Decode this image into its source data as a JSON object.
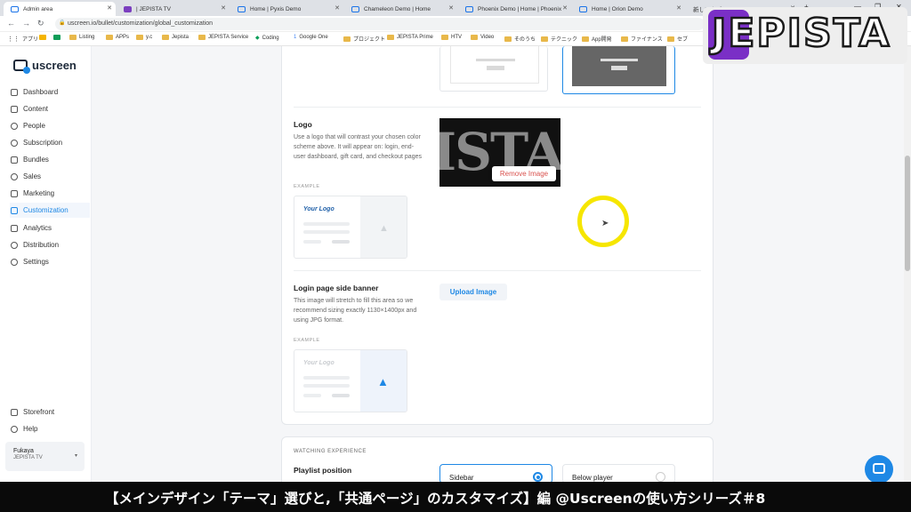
{
  "browser": {
    "tabs": [
      {
        "title": "Admin area"
      },
      {
        "title": "| JEPISTA TV"
      },
      {
        "title": "Home | Pyxis Demo"
      },
      {
        "title": "Chameleon Demo | Home"
      },
      {
        "title": "Phoenix Demo | Home | Phoenix"
      },
      {
        "title": "Home | Orion Demo"
      },
      {
        "title": "新しいタブ"
      }
    ],
    "new_tab": "+",
    "url": "uscreen.io/bullet/customization/global_customization",
    "bookmarks": [
      "アプリ",
      "Listing",
      "APPs",
      "y.c",
      "Jepista",
      "JEPISTA Service",
      "Coding",
      "Google One",
      "プロジェクト",
      "JEPISTA Prime",
      "HTV",
      "Video",
      "そのうち",
      "テクニック",
      "App開発",
      "ファイナンス",
      "セブ"
    ]
  },
  "sidebar": {
    "brand": "uscreen",
    "items": [
      {
        "label": "Dashboard"
      },
      {
        "label": "Content"
      },
      {
        "label": "People"
      },
      {
        "label": "Subscription"
      },
      {
        "label": "Bundles"
      },
      {
        "label": "Sales"
      },
      {
        "label": "Marketing"
      },
      {
        "label": "Customization"
      },
      {
        "label": "Analytics"
      },
      {
        "label": "Distribution"
      },
      {
        "label": "Settings"
      }
    ],
    "bottom_items": [
      {
        "label": "Storefront"
      },
      {
        "label": "Help"
      }
    ],
    "account": {
      "name": "Fukaya",
      "subtitle": "JEPISTA TV"
    }
  },
  "logo_section": {
    "title": "Logo",
    "description": "Use a logo that will contrast your chosen color scheme above. It will appear on: login, end-user dashboard, gift card, and checkout pages",
    "example_label": "EXAMPLE",
    "example_logo_text": "Your Logo",
    "preview_text": "ISTA",
    "remove_button": "Remove Image"
  },
  "banner_section": {
    "title": "Login page side banner",
    "description": "This image will stretch to fill this area so we recommend sizing exactly 1130×1400px and using JPG format.",
    "example_label": "EXAMPLE",
    "example_logo_text": "Your Logo",
    "upload_button": "Upload Image"
  },
  "watching": {
    "heading": "WATCHING EXPERIENCE",
    "playlist_title": "Playlist position",
    "options": [
      {
        "label": "Sidebar",
        "selected": true
      },
      {
        "label": "Below player",
        "selected": false
      }
    ]
  },
  "watermark": {
    "brand": "JEPISTA"
  },
  "caption": {
    "text": "【メインデザイン「テーマ」選びと,「共通ページ」のカスタマイズ】編  @Uscreenの使い方シリーズ＃8"
  },
  "colors": {
    "accent": "#1e88e5",
    "danger": "#d9534f",
    "cursor_ring": "#f6e600",
    "brand_purple": "#7a2fc6"
  }
}
